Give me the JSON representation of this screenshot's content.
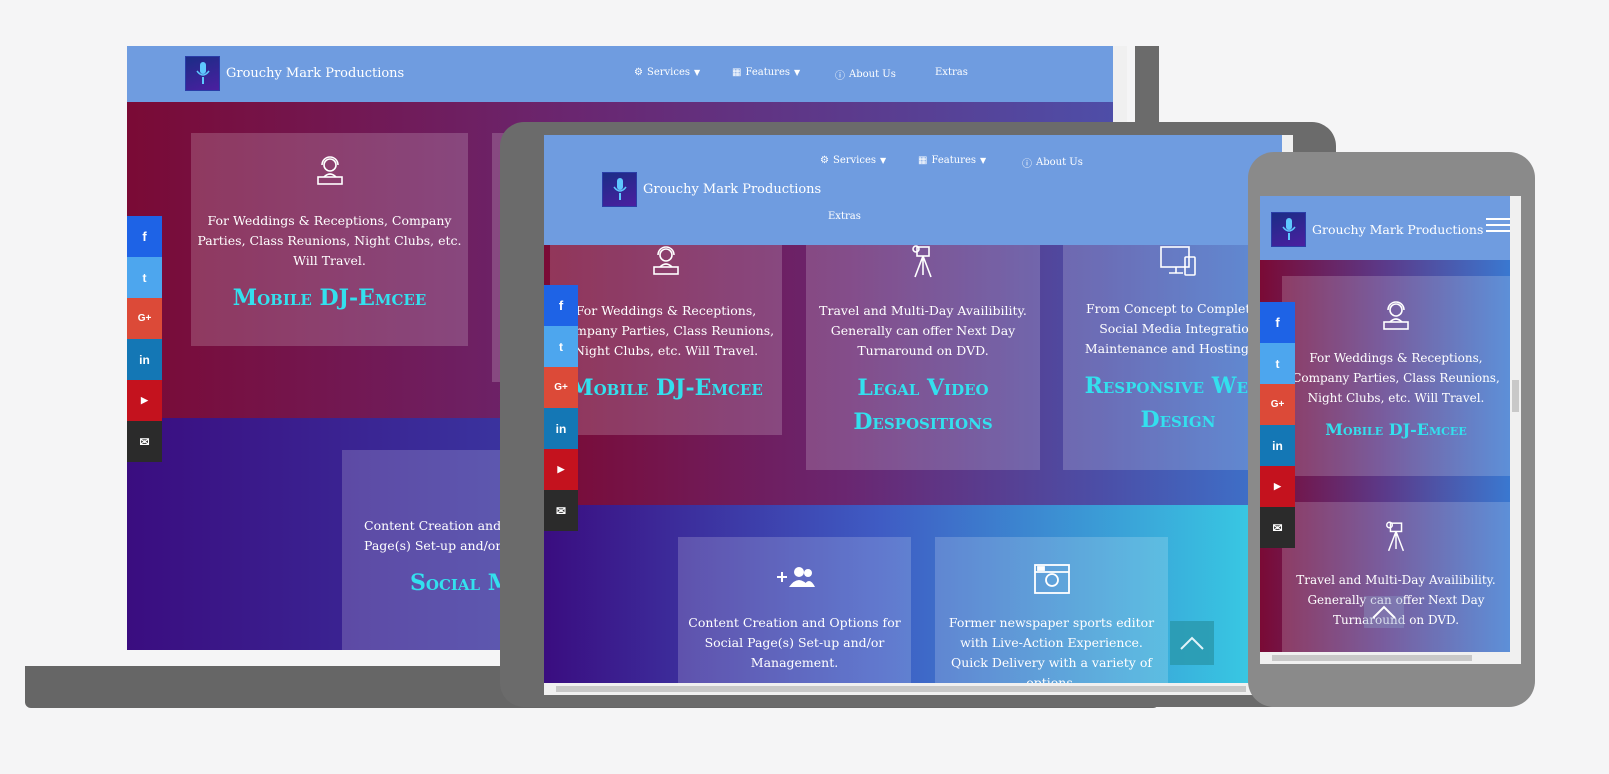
{
  "site": {
    "brand": "Grouchy Mark Productions"
  },
  "nav": {
    "services": "Services",
    "features": "Features",
    "about": "About Us",
    "extras": "Extras"
  },
  "social": {
    "facebook": "f",
    "twitter": "t",
    "googleplus": "G+",
    "linkedin": "in",
    "youtube": "▶",
    "email": "✉"
  },
  "cards": {
    "dj": {
      "desc_a": "For Weddings & Receptions, Company Parties, Class Reunions, Night Clubs, etc. Will Travel.",
      "desc_b": "For Weddings & Receptions, Company Parties, Class Reunions, Night Clubs, etc. Will Travel.",
      "title": "Mobile DJ-Emcee"
    },
    "legal": {
      "desc": "Travel and Multi-Day Availibility. Generally can offer Next Day Turnaround on DVD.",
      "title_1": "Legal Video",
      "title_2": "Despositions"
    },
    "web": {
      "desc": "From Concept to Completion Social Media Integration Maintenance and Hosting Op",
      "title_1": "Responsive Webs",
      "title_2": "Design"
    },
    "social": {
      "desc_desktop": "Content Creation and C Page(s) Set-up and/or",
      "title_desktop": "Social M",
      "desc": "Content Creation and Options for Social Page(s) Set-up and/or Management."
    },
    "photo": {
      "desc": "Former newspaper sports editor with Live-Action Experience. Quick Delivery with a variety of options."
    }
  },
  "colors": {
    "nav": "#6f9ce0",
    "accent": "#33e0ee",
    "frame": "#6b6b6b"
  }
}
